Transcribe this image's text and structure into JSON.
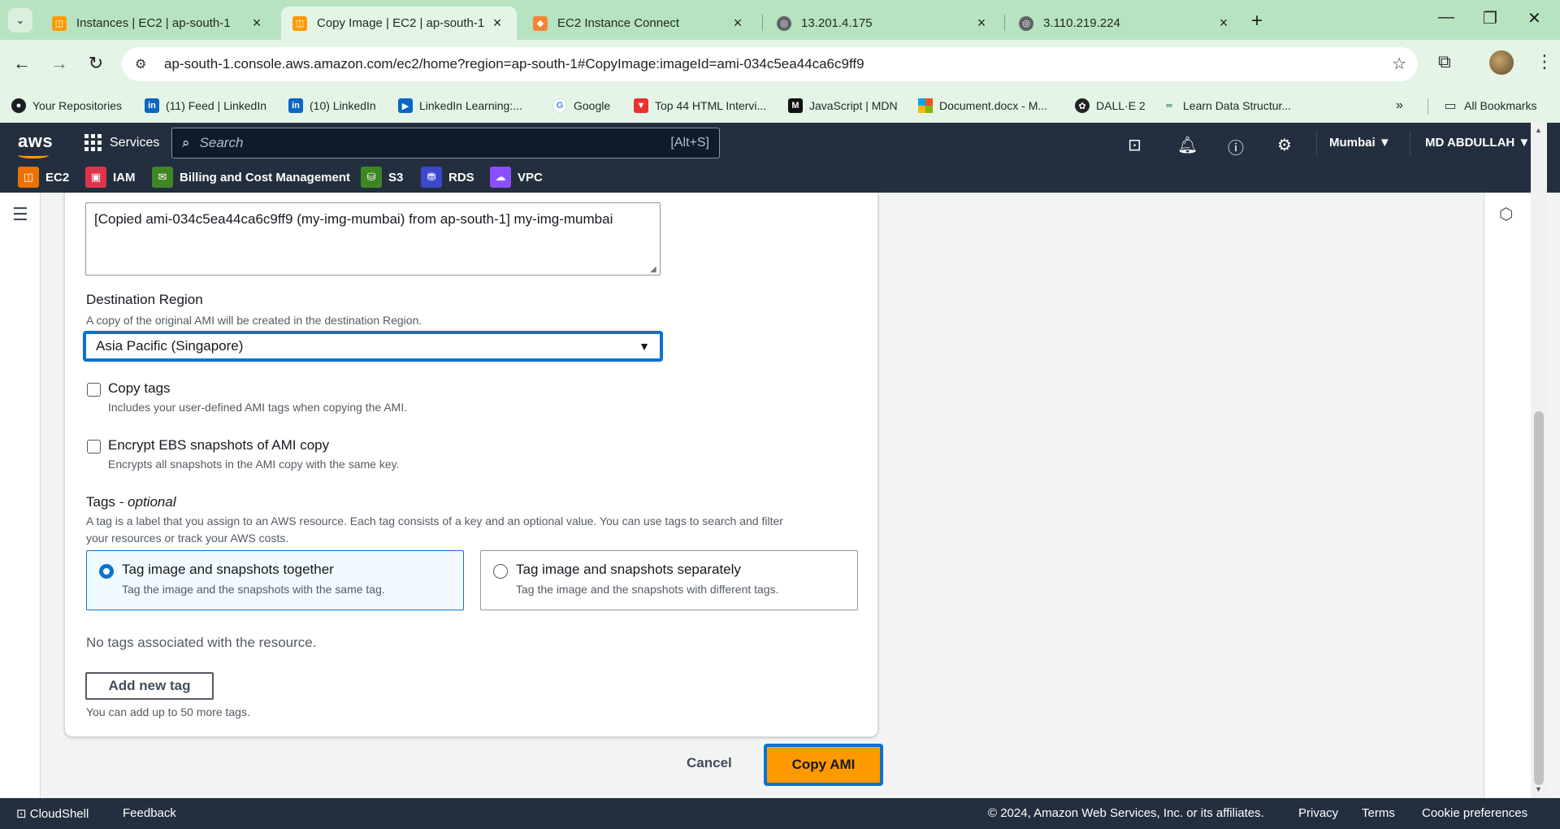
{
  "browser": {
    "tabs": [
      {
        "label": "Instances | EC2 | ap-south-1",
        "favicon_color": "#ff9900"
      },
      {
        "label": "Copy Image | EC2 | ap-south-1",
        "favicon_color": "#ff9900"
      },
      {
        "label": "EC2 Instance Connect",
        "favicon_color": "#f58536"
      },
      {
        "label": "13.201.4.175",
        "favicon_color": "#5f6368"
      },
      {
        "label": "3.110.219.224",
        "favicon_color": "#5f6368"
      }
    ],
    "active_tab_index": 1,
    "url": "ap-south-1.console.aws.amazon.com/ec2/home?region=ap-south-1#CopyImage:imageId=ami-034c5ea44ca6c9ff9",
    "bookmarks": [
      {
        "label": "Your Repositories",
        "icon": "github-icon"
      },
      {
        "label": "(11) Feed | LinkedIn",
        "icon": "linkedin-icon"
      },
      {
        "label": "(10) LinkedIn",
        "icon": "linkedin-icon"
      },
      {
        "label": "LinkedIn Learning:...",
        "icon": "play-icon"
      },
      {
        "label": "Google",
        "icon": "google-icon"
      },
      {
        "label": "Top 44 HTML Intervi...",
        "icon": "v-icon"
      },
      {
        "label": "JavaScript | MDN",
        "icon": "mdn-icon"
      },
      {
        "label": "Document.docx - M...",
        "icon": "microsoft-icon"
      },
      {
        "label": "DALL·E 2",
        "icon": "openai-icon"
      },
      {
        "label": "Learn Data Structur...",
        "icon": "gfg-icon"
      }
    ],
    "all_bookmarks": "All Bookmarks"
  },
  "aws": {
    "logo": "aws",
    "services": "Services",
    "search_placeholder": "Search",
    "search_shortcut": "[Alt+S]",
    "region": "Mumbai",
    "user": "MD ABDULLAH",
    "favorites": [
      {
        "label": "EC2",
        "color": "#ed7100"
      },
      {
        "label": "IAM",
        "color": "#dd344c"
      },
      {
        "label": "Billing and Cost Management",
        "color": "#3f8624"
      },
      {
        "label": "S3",
        "color": "#3f8624"
      },
      {
        "label": "RDS",
        "color": "#3b48cc"
      },
      {
        "label": "VPC",
        "color": "#8c4fff"
      }
    ]
  },
  "form": {
    "description_value": "[Copied ami-034c5ea44ca6c9ff9 (my-img-mumbai) from ap-south-1] my-img-mumbai",
    "destination_region": {
      "label": "Destination Region",
      "help": "A copy of the original AMI will be created in the destination Region.",
      "selected": "Asia Pacific (Singapore)"
    },
    "copy_tags": {
      "label": "Copy tags",
      "help": "Includes your user-defined AMI tags when copying the AMI.",
      "checked": false
    },
    "encrypt": {
      "label": "Encrypt EBS snapshots of AMI copy",
      "help": "Encrypts all snapshots in the AMI copy with the same key.",
      "checked": false
    },
    "tags": {
      "label": "Tags",
      "optional": "- optional",
      "help_line1": "A tag is a label that you assign to an AWS resource. Each tag consists of a key and an optional value. You can use tags to search and filter",
      "help_line2": "your resources or track your AWS costs.",
      "options": [
        {
          "title": "Tag image and snapshots together",
          "sub": "Tag the image and the snapshots with the same tag.",
          "selected": true
        },
        {
          "title": "Tag image and snapshots separately",
          "sub": "Tag the image and the snapshots with different tags.",
          "selected": false
        }
      ],
      "empty_text": "No tags associated with the resource.",
      "add_button": "Add new tag",
      "limit_text": "You can add up to 50 more tags."
    },
    "cancel": "Cancel",
    "submit": "Copy AMI"
  },
  "footer": {
    "cloudshell": "CloudShell",
    "feedback": "Feedback",
    "copyright": "© 2024, Amazon Web Services, Inc. or its affiliates.",
    "privacy": "Privacy",
    "terms": "Terms",
    "cookies": "Cookie preferences"
  }
}
